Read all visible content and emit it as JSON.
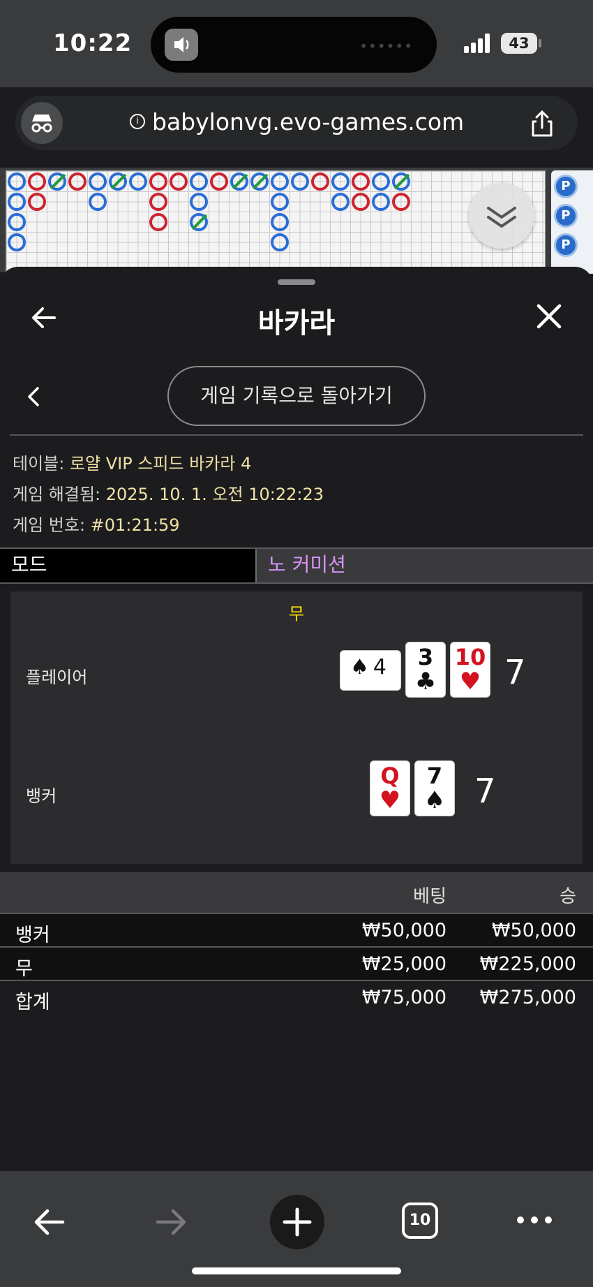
{
  "status_bar": {
    "time": "10:22",
    "battery": "43"
  },
  "browser": {
    "url": "babylonvg.evo-games.com",
    "tab_count": "10"
  },
  "sheet": {
    "title": "바카라",
    "back_to_history": "게임 기록으로 돌아가기",
    "info": {
      "table_label": "테이블: ",
      "table_value": "로얄 VIP 스피드 바카라 4",
      "resolved_label": "게임 해결됨: ",
      "resolved_value": "2025. 10. 1. 오전 10:22:23",
      "number_label": "게임 번호: ",
      "number_value": "#01:21:59"
    },
    "mode": {
      "label": "모드",
      "value": "노 커미션"
    }
  },
  "result": {
    "outcome": "무",
    "player": {
      "label": "플레이어",
      "score": "7",
      "cards": [
        {
          "rank": "4",
          "suit": "♠",
          "color": "black",
          "sideways": true
        },
        {
          "rank": "3",
          "suit": "♣",
          "color": "black",
          "sideways": false
        },
        {
          "rank": "10",
          "suit": "♥",
          "color": "red",
          "sideways": false
        }
      ]
    },
    "banker": {
      "label": "뱅커",
      "score": "7",
      "cards": [
        {
          "rank": "Q",
          "suit": "♥",
          "color": "red",
          "sideways": false
        },
        {
          "rank": "7",
          "suit": "♠",
          "color": "black",
          "sideways": false
        }
      ]
    }
  },
  "bets": {
    "header": {
      "bet": "베팅",
      "win": "승"
    },
    "rows": [
      {
        "label": "뱅커",
        "bet": "₩50,000",
        "win": "₩50,000"
      },
      {
        "label": "무",
        "bet": "₩25,000",
        "win": "₩225,000"
      },
      {
        "label": "합계",
        "bet": "₩75,000",
        "win": "₩275,000"
      }
    ]
  },
  "colors": {
    "player_blue": "#2b6dd6",
    "banker_red": "#cc2430",
    "tie_green": "#1f9b3a",
    "highlight_yellow": "#ffe100",
    "mode_purple": "#d694f5"
  },
  "icons": [
    "incognito-icon",
    "info-icon",
    "share-icon",
    "back-arrow-icon",
    "close-icon",
    "chevron-left-icon",
    "chevron-double-down-icon",
    "nav-back-icon",
    "nav-forward-icon",
    "new-tab-icon",
    "tabs-icon",
    "more-icon"
  ]
}
